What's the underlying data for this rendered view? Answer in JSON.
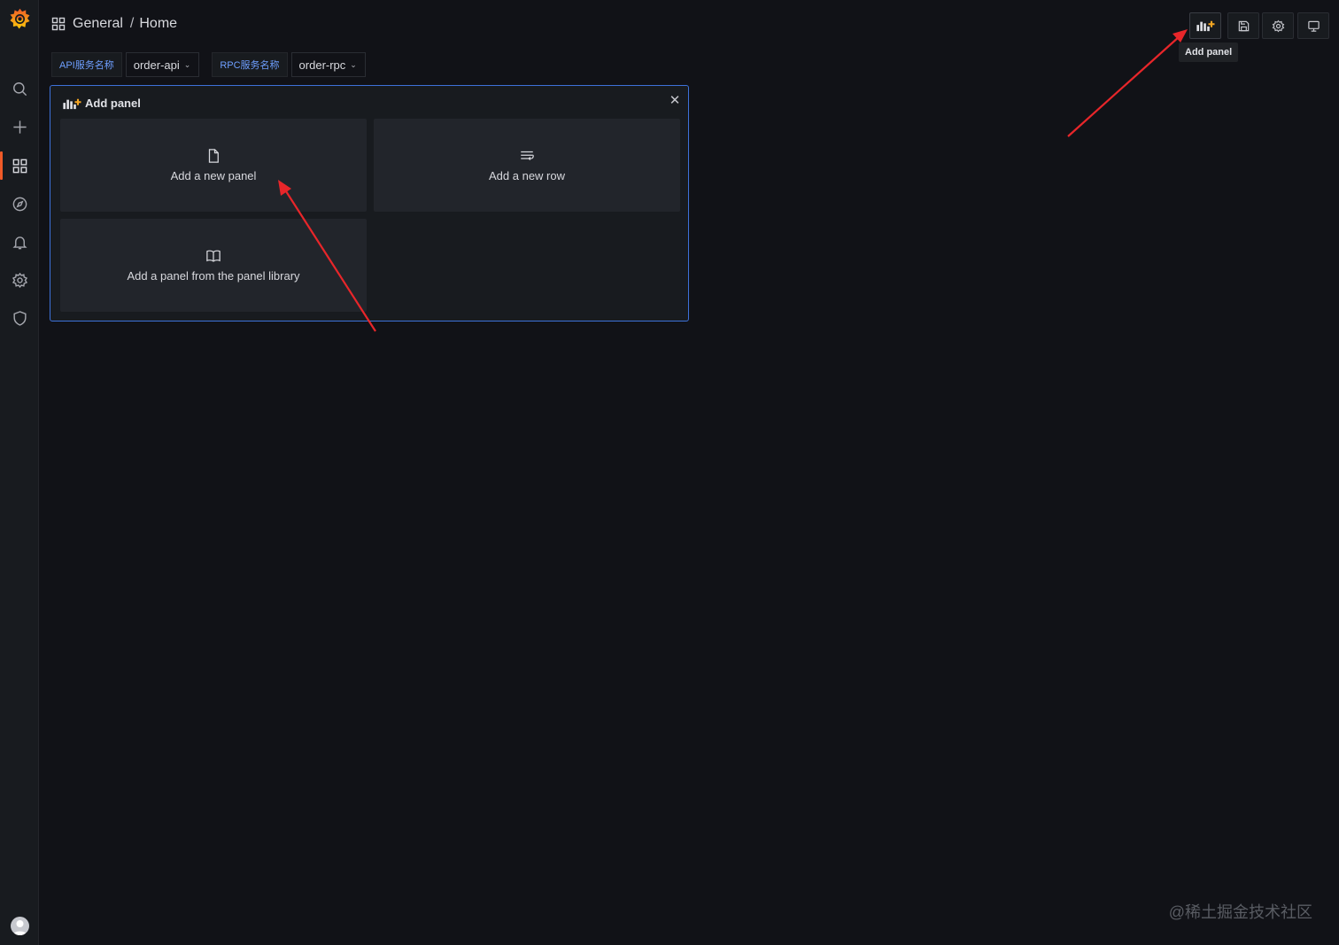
{
  "breadcrumb": {
    "folder": "General",
    "separator": "/",
    "dashboard": "Home"
  },
  "toolbar": {
    "add_panel_icon": "add-panel-icon",
    "save_icon": "save-icon",
    "settings_icon": "gear-icon",
    "tv_icon": "monitor-icon",
    "tooltip": "Add panel"
  },
  "variables": [
    {
      "label": "API服务名称",
      "value": "order-api"
    },
    {
      "label": "RPC服务名称",
      "value": "order-rpc"
    }
  ],
  "add_panel": {
    "title": "Add panel",
    "options": [
      {
        "label": "Add a new panel",
        "icon": "file-icon"
      },
      {
        "label": "Add a new row",
        "icon": "row-icon"
      },
      {
        "label": "Add a panel from the panel library",
        "icon": "book-icon"
      }
    ]
  },
  "sidebar": {
    "items": [
      "search-icon",
      "plus-icon",
      "dashboards-icon",
      "explore-icon",
      "alert-bell-icon",
      "gear-icon",
      "shield-icon"
    ],
    "active": "dashboards-icon"
  },
  "colors": {
    "accent": "#f05a28",
    "panel_border": "#3d71d9",
    "annotation_arrow": "#e8262a"
  },
  "watermark": "@稀土掘金技术社区"
}
